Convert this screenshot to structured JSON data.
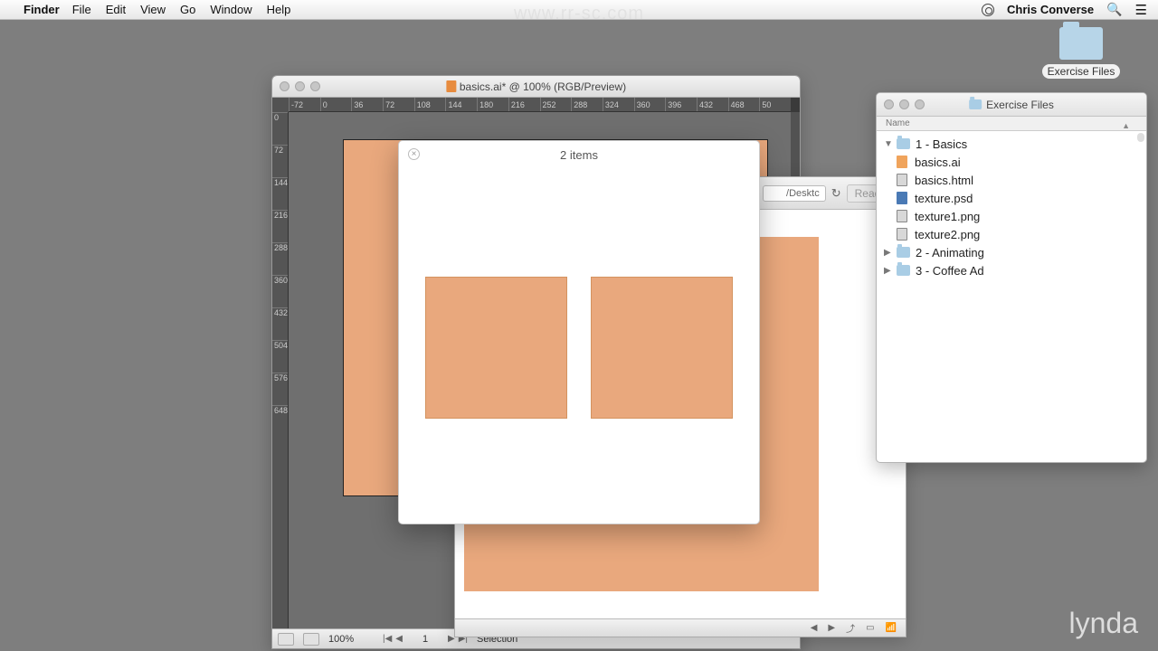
{
  "menubar": {
    "app_name": "Finder",
    "items": [
      "File",
      "Edit",
      "View",
      "Go",
      "Window",
      "Help"
    ],
    "username": "Chris Converse"
  },
  "watermark_url": "www.rr-sc.com",
  "desktop": {
    "folder_label": "Exercise Files"
  },
  "ai_window": {
    "title": "basics.ai* @ 100% (RGB/Preview)",
    "ruler_h": [
      "-72",
      "0",
      "36",
      "72",
      "108",
      "144",
      "180",
      "216",
      "252",
      "288",
      "324",
      "360",
      "396",
      "432",
      "468",
      "50"
    ],
    "ruler_v": [
      "0",
      "72",
      "144",
      "216",
      "288",
      "360",
      "432",
      "504",
      "576",
      "648"
    ],
    "zoom": "100%",
    "page": "1",
    "status": "Selection"
  },
  "safari": {
    "addr": "/Desktc",
    "reader": "Reader"
  },
  "items_panel": {
    "title": "2 items"
  },
  "finder": {
    "title": "Exercise Files",
    "col_name": "Name",
    "items": [
      {
        "type": "folder",
        "label": "1 - Basics",
        "expanded": true,
        "children": [
          {
            "type": "ai",
            "label": "basics.ai"
          },
          {
            "type": "html",
            "label": "basics.html"
          },
          {
            "type": "psd",
            "label": "texture.psd"
          },
          {
            "type": "png",
            "label": "texture1.png"
          },
          {
            "type": "png",
            "label": "texture2.png"
          }
        ]
      },
      {
        "type": "folder",
        "label": "2 - Animating",
        "expanded": false
      },
      {
        "type": "folder",
        "label": "3 - Coffee Ad",
        "expanded": false
      }
    ]
  },
  "branding": {
    "lynda": "lynda",
    ".com": ".com"
  }
}
